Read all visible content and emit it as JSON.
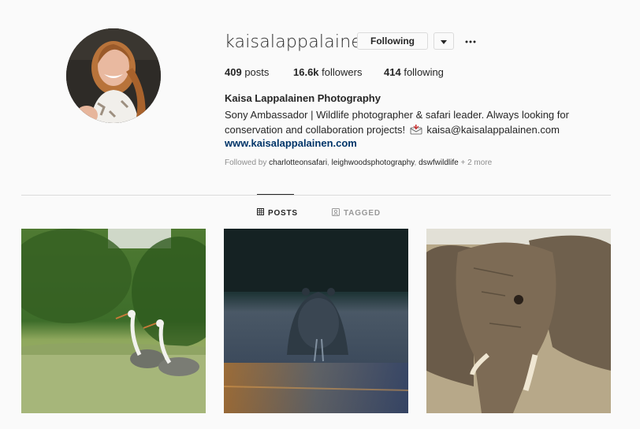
{
  "profile": {
    "username": "kaisalappalainen",
    "follow_label": "Following",
    "more_icon": "more-horizontal-icon",
    "stats": {
      "posts_count": "409",
      "posts_label": "posts",
      "followers_count": "16.6k",
      "followers_label": "followers",
      "following_count": "414",
      "following_label": "following"
    },
    "bio": {
      "name": "Kaisa Lappalainen Photography",
      "line1": "Sony Ambassador | Wildlife photographer & safari leader. Always looking for",
      "line2_start": "conservation and collaboration projects!",
      "email": "kaisa@kaisalappalainen.com",
      "link": "www.kaisalappalainen.com"
    },
    "followed_by": {
      "prefix": "Followed by",
      "user1": "charlotteonsafari",
      "user2": "leighwoodsphotography",
      "user3": "dswfwildlife",
      "suffix": "+ 2 more"
    }
  },
  "tabs": {
    "posts": "POSTS",
    "tagged": "TAGGED"
  },
  "colors": {
    "text": "#262626",
    "muted": "#8e8e8e",
    "link": "#003569",
    "border": "#dbdbdb",
    "background": "#fafafa"
  }
}
